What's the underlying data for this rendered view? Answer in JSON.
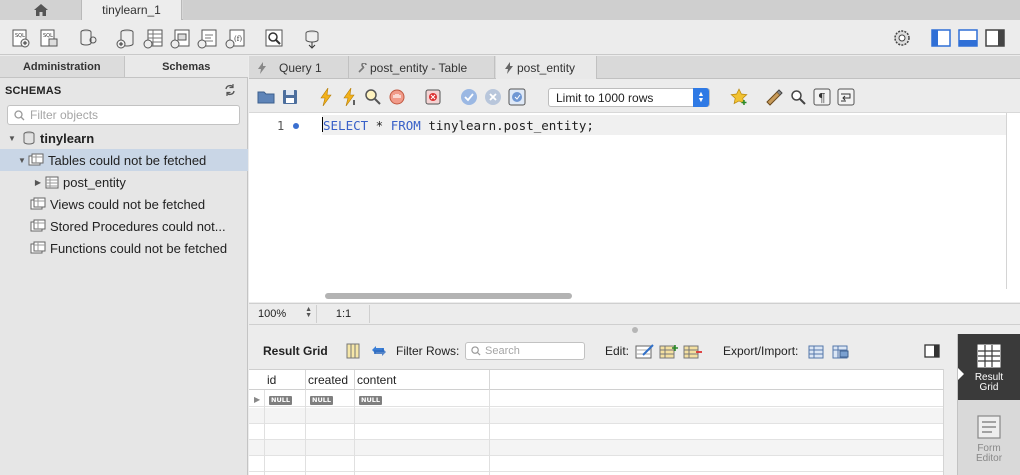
{
  "connection_tabs": {
    "home_icon": "home-icon",
    "active_label": "tinylearn_1"
  },
  "main_toolbar": {
    "icons": [
      "new-sql-tab-icon",
      "open-sql-script-icon",
      "inspector-icon",
      "create-schema-icon",
      "create-table-icon",
      "create-view-icon",
      "create-procedure-icon",
      "create-function-icon",
      "search-table-data-icon",
      "reconnect-icon"
    ],
    "right_icons": [
      "settings-icon",
      "toggle-sidebar-icon",
      "toggle-output-icon",
      "toggle-secondary-sidebar-icon"
    ]
  },
  "sidebar": {
    "tabs": [
      "Administration",
      "Schemas"
    ],
    "active_tab": "Schemas",
    "heading": "SCHEMAS",
    "filter_placeholder": "Filter objects",
    "tree": {
      "schema": "tinylearn",
      "tables_node": "Tables could not be fetched",
      "table": "post_entity",
      "views_node": "Views could not be fetched",
      "procedures_node": "Stored Procedures could not...",
      "functions_node": "Functions could not be fetched"
    }
  },
  "query_tabs": [
    {
      "label": "Query 1",
      "icon": "lightning-icon"
    },
    {
      "label": "post_entity - Table",
      "icon": "wrench-icon"
    },
    {
      "label": "post_entity",
      "icon": "lightning-icon"
    }
  ],
  "editor_toolbar": {
    "limit_value": "Limit to 1000 rows",
    "icons": [
      "open-file-icon",
      "save-icon",
      "execute-icon",
      "execute-current-icon",
      "explain-icon",
      "stop-icon",
      "toggle-continue-on-error-icon",
      "commit-icon",
      "rollback-icon",
      "autocommit-icon",
      "add-snippet-icon",
      "beautify-icon",
      "find-icon",
      "invisible-chars-icon",
      "wrap-lines-icon"
    ]
  },
  "editor": {
    "line_number": "1",
    "sql": {
      "kw1": "SELECT",
      "mid1": " * ",
      "kw2": "FROM",
      "rest": " tinylearn.post_entity;"
    }
  },
  "status": {
    "zoom": "100%",
    "position": "1:1"
  },
  "result_toolbar": {
    "title": "Result Grid",
    "filter_label": "Filter Rows:",
    "search_placeholder": "Search",
    "edit_label": "Edit:",
    "export_label": "Export/Import:"
  },
  "result_grid": {
    "columns": [
      "id",
      "created",
      "content"
    ],
    "row": [
      "NULL",
      "NULL",
      "NULL"
    ]
  },
  "side_panel": {
    "result_grid_label_1": "Result",
    "result_grid_label_2": "Grid",
    "form_editor_label_1": "Form",
    "form_editor_label_2": "Editor"
  },
  "colors": {
    "accent": "#2f7ae5",
    "keyword": "#3860c8",
    "selected_row": "#c9d6e6"
  }
}
